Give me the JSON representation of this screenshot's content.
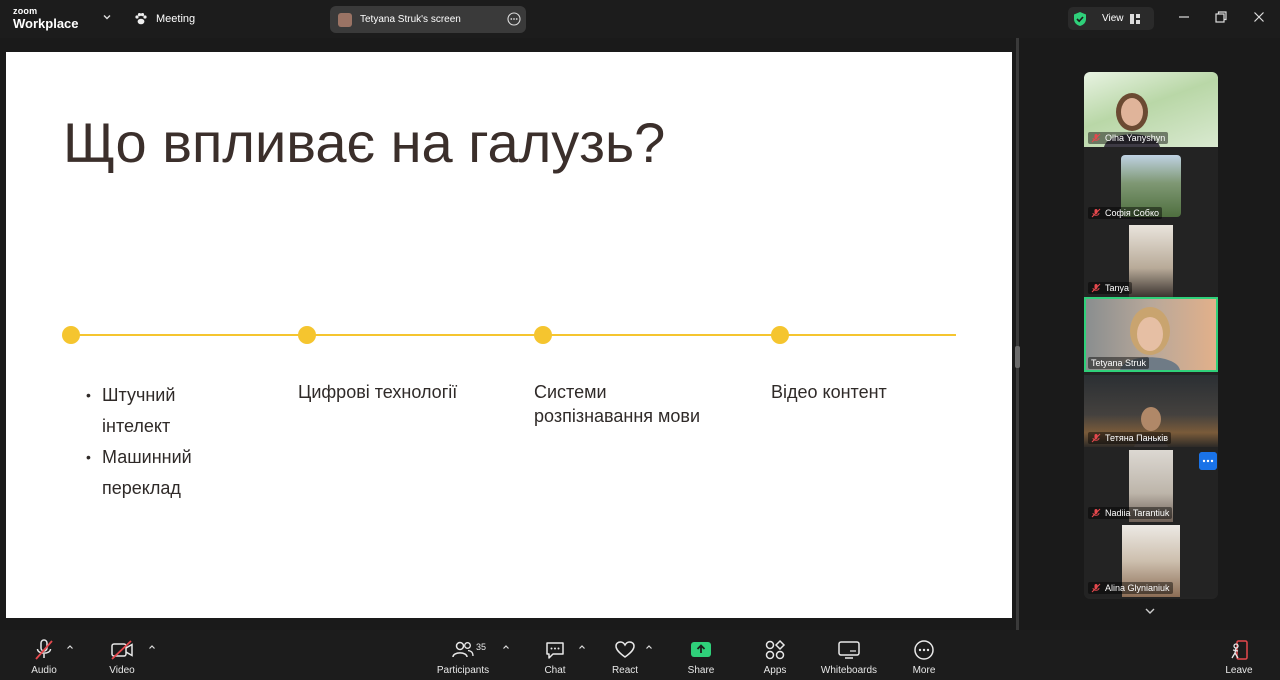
{
  "app": {
    "brand_top": "zoom",
    "brand_bottom": "Workplace",
    "meeting_label": "Meeting"
  },
  "share": {
    "label": "Tetyana Struk's screen"
  },
  "view": {
    "label": "View"
  },
  "slide": {
    "title": "Що впливає на галузь?",
    "columns": [
      {
        "bullets": [
          "Штучний інтелект",
          "Машинний переклад"
        ]
      },
      {
        "text": "Цифрові технології"
      },
      {
        "text": "Системи розпізнавання мови"
      },
      {
        "text": "Відео контент"
      }
    ]
  },
  "participants": [
    {
      "name": "Olha Yanyshyn",
      "muted": true
    },
    {
      "name": "Софія Собко",
      "muted": true
    },
    {
      "name": "Tanya",
      "muted": true
    },
    {
      "name": "Tetyana Struk",
      "muted": false,
      "speaking": true
    },
    {
      "name": "Тетяна Паньків",
      "muted": true
    },
    {
      "name": "Nadiia Tarantiuk",
      "muted": true
    },
    {
      "name": "Alina Glynianiuk",
      "muted": true
    }
  ],
  "toolbar": {
    "audio": "Audio",
    "video": "Video",
    "participants": "Participants",
    "participants_count": "35",
    "chat": "Chat",
    "react": "React",
    "share": "Share",
    "apps": "Apps",
    "whiteboards": "Whiteboards",
    "more": "More",
    "leave": "Leave"
  },
  "colors": {
    "accent_yellow": "#f5c52f",
    "share_green": "#2fd07a",
    "active_border": "#2fd07a",
    "mute_red": "#e5484d"
  }
}
